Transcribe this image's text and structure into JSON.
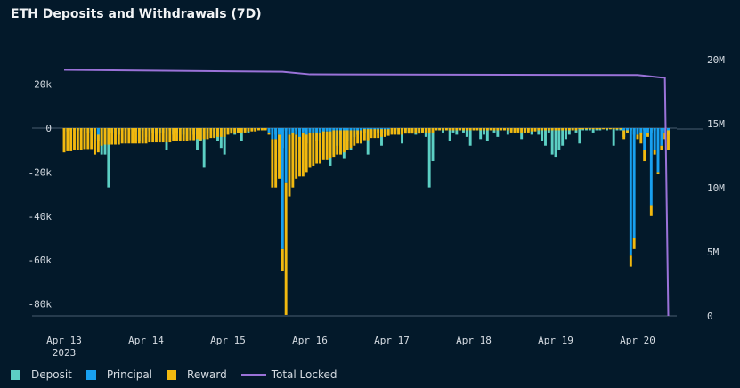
{
  "chart_data": {
    "type": "bar",
    "title": "ETH Deposits and Withdrawals (7D)",
    "stacked": true,
    "x_ticks": [
      "Apr 13",
      "Apr 14",
      "Apr 15",
      "Apr 16",
      "Apr 17",
      "Apr 18",
      "Apr 19",
      "Apr 20"
    ],
    "x_tick_year": "2023",
    "y_left": {
      "ticks": [
        20000,
        0,
        -20000,
        -40000,
        -60000,
        -80000
      ],
      "tick_labels": [
        "20k",
        "0",
        "-20k",
        "-40k",
        "-60k",
        "-80k"
      ],
      "range": [
        -85400,
        31200
      ]
    },
    "y_right": {
      "ticks": [
        20000000,
        15000000,
        10000000,
        5000000,
        0
      ],
      "tick_labels": [
        "20M",
        "15M",
        "10M",
        "5M",
        "0"
      ],
      "range": [
        0,
        20000000
      ]
    },
    "grid": false,
    "legend_position": "bottom-left",
    "colors": {
      "Deposit": "#5ccfc4",
      "Principal": "#18a0f0",
      "Reward": "#f2b90f",
      "Total Locked": "#9a72d8",
      "background": "#03192a"
    },
    "legend": [
      "Deposit",
      "Principal",
      "Reward",
      "Total Locked"
    ],
    "unit_bars": "thousand ETH per hour",
    "hourly_bars": [
      {
        "date": "2023-04-13",
        "deposit": [
          1,
          1.5,
          1,
          0.5,
          1,
          1,
          0.5,
          2,
          1,
          5,
          6,
          12,
          12,
          27,
          2,
          0.5,
          3,
          1,
          1,
          0.8,
          0.5,
          1.5,
          6,
          1
        ],
        "principal": [
          0,
          0,
          0,
          0,
          0,
          0,
          0,
          0,
          0,
          0,
          -3,
          0,
          0,
          0,
          0,
          0,
          0,
          0,
          0,
          0,
          0,
          0,
          0,
          0
        ],
        "reward": [
          -11,
          -10.5,
          -10.5,
          -10,
          -10,
          -10,
          -9.5,
          -9.5,
          -9.5,
          -12,
          -8,
          -8,
          -7.5,
          -7.5,
          -7.5,
          -7.5,
          -7.5,
          -7,
          -7,
          -7,
          -7,
          -7,
          -7,
          -7
        ]
      },
      {
        "date": "2023-04-14",
        "deposit": [
          4,
          1,
          2,
          3,
          2,
          2,
          10,
          1,
          3,
          2,
          0.5,
          3,
          5,
          1,
          3,
          10,
          6,
          18,
          2,
          1,
          4,
          6,
          9,
          12
        ],
        "principal": [
          0,
          0,
          0,
          0,
          0,
          0,
          0,
          0,
          0,
          0,
          0,
          0,
          0,
          0,
          0,
          0,
          0,
          0,
          0,
          0,
          0,
          0,
          0,
          0
        ],
        "reward": [
          -7,
          -6.5,
          -6.5,
          -6.5,
          -6.5,
          -6.5,
          -6.5,
          -6.5,
          -6,
          -6,
          -6,
          -6,
          -6,
          -5.5,
          -5.5,
          -5,
          -5.5,
          -5,
          -5,
          -4.5,
          -4.5,
          -4,
          -4,
          -4
        ]
      },
      {
        "date": "2023-04-15",
        "deposit": [
          2,
          1,
          3,
          2,
          6,
          1,
          2,
          1,
          0.5,
          1,
          1,
          0.5,
          0.5,
          0.5,
          3,
          2,
          9,
          1,
          1,
          3,
          1,
          5,
          1,
          7
        ],
        "principal": [
          0,
          0,
          0,
          0,
          0,
          0,
          0,
          0,
          0,
          0,
          0,
          0,
          -2,
          -5,
          -5,
          -3,
          -55,
          -25,
          -3,
          -2,
          -3,
          -4,
          -2,
          -3
        ],
        "reward": [
          -3,
          -2.5,
          -2.5,
          -2,
          -2,
          -2,
          -1.5,
          -1.5,
          -1.5,
          -1,
          -1,
          -1,
          -1,
          -22,
          -22,
          -20,
          -10,
          -60,
          -28,
          -25,
          -20,
          -18,
          -20,
          -17
        ]
      },
      {
        "date": "2023-04-16",
        "deposit": [
          1,
          2,
          6,
          1,
          2,
          1,
          17,
          12,
          8,
          3,
          14,
          6,
          10,
          4,
          3,
          7,
          2,
          12,
          3,
          1,
          2,
          8,
          2,
          3
        ],
        "principal": [
          -2,
          -2,
          -2,
          -2,
          -1.5,
          -1.5,
          -1.5,
          -1,
          -1,
          -1,
          -1,
          -1,
          -1,
          -1,
          -1,
          -1,
          -0.5,
          -0.5,
          -0.5,
          -0.5,
          -0.5,
          -0.5,
          -0.5,
          -0.5
        ],
        "reward": [
          -16,
          -15,
          -14,
          -14,
          -13,
          -13,
          -12,
          -12,
          -11,
          -11,
          -10,
          -9,
          -8,
          -7,
          -6,
          -6,
          -5,
          -5,
          -4,
          -4,
          -4,
          -3.5,
          -3.5,
          -3
        ]
      },
      {
        "date": "2023-04-17",
        "deposit": [
          2,
          1,
          3,
          7,
          1,
          2,
          1,
          3,
          2,
          2,
          4,
          27,
          15,
          1,
          1,
          2,
          1,
          6,
          2,
          3,
          1,
          2,
          4,
          8
        ],
        "principal": [
          0,
          0,
          0,
          0,
          0,
          0,
          0,
          0,
          0,
          0,
          0,
          0,
          0,
          0,
          0,
          0,
          0,
          0,
          0,
          0,
          0,
          0,
          0,
          0
        ],
        "reward": [
          -3,
          -3,
          -3,
          -3,
          -2.5,
          -2.5,
          -2.5,
          -2.5,
          -2.5,
          -2,
          -2,
          -2,
          -2,
          -1,
          -1,
          -1,
          -1,
          -1,
          -1,
          -1,
          -1,
          -1,
          -1,
          -1
        ]
      },
      {
        "date": "2023-04-18",
        "deposit": [
          1,
          1,
          5,
          3,
          6,
          1,
          2,
          4,
          1,
          1,
          3,
          1,
          2,
          1,
          5,
          2,
          1,
          3,
          1,
          3,
          6,
          8,
          2,
          12
        ],
        "principal": [
          0,
          0,
          0,
          0,
          0,
          0,
          0,
          0,
          0,
          0,
          0,
          0,
          0,
          0,
          0,
          0,
          0,
          0,
          0,
          0,
          0,
          0,
          0,
          0
        ],
        "reward": [
          -1,
          -1,
          -1,
          -1,
          -1,
          -1,
          -1,
          -1,
          -1,
          -1,
          -1,
          -2,
          -2,
          -2,
          -2,
          -2,
          -2,
          -1.5,
          -1.5,
          -1,
          -1,
          -1,
          -1,
          -1
        ]
      },
      {
        "date": "2023-04-19",
        "deposit": [
          13,
          10,
          8,
          5,
          3,
          1,
          2,
          7,
          1,
          1,
          1,
          2,
          1,
          1,
          0.5,
          1,
          0.5,
          8,
          1,
          1,
          4,
          2,
          1,
          3
        ],
        "principal": [
          0,
          0,
          0,
          0,
          0,
          0,
          0,
          0,
          0,
          0,
          0,
          0,
          0,
          0,
          0,
          0,
          0,
          0,
          0,
          0,
          -1,
          -1,
          -58,
          -50
        ],
        "reward": [
          -1,
          -1,
          -1,
          -1,
          -1,
          -1,
          -1,
          -0.5,
          -0.5,
          -0.5,
          -0.5,
          -0.5,
          -0.5,
          -0.5,
          -0.5,
          -0.5,
          -0.5,
          -0.5,
          -0.5,
          -0.5,
          -4,
          -1,
          -5,
          -5
        ]
      },
      {
        "date": "2023-04-20",
        "deposit": [
          1,
          3,
          1,
          0.5,
          2,
          1,
          0.5,
          1,
          1,
          3
        ],
        "principal": [
          -3,
          -2,
          -10,
          -2,
          -35,
          -10,
          -20,
          -8,
          -2,
          -1
        ],
        "reward": [
          -2,
          -5,
          -5,
          -2,
          -5,
          -2,
          -1,
          -2,
          -3,
          -9
        ]
      }
    ],
    "total_locked": [
      {
        "x": "2023-04-13T00:00",
        "y": 19200000
      },
      {
        "x": "2023-04-15T16:00",
        "y": 19050000
      },
      {
        "x": "2023-04-16T00:00",
        "y": 18850000
      },
      {
        "x": "2023-04-20T00:00",
        "y": 18800000
      },
      {
        "x": "2023-04-20T07:00",
        "y": 18600000
      },
      {
        "x": "2023-04-20T08:00",
        "y": 18600000
      },
      {
        "x": "2023-04-20T09:00",
        "y": 0
      }
    ]
  }
}
